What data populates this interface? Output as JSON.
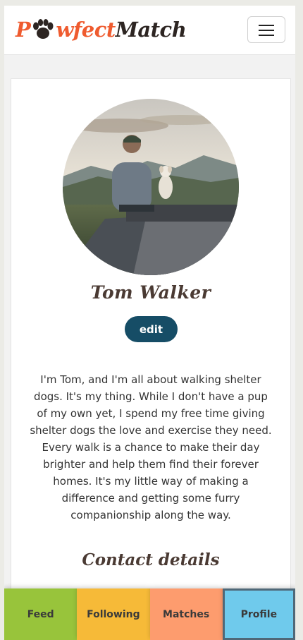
{
  "brand": {
    "part1": "P",
    "part2": "wfect",
    "part3": "Match"
  },
  "colors": {
    "brand_orange": "#ef5b2f",
    "edit_button": "#164d66",
    "tab_feed": "#98c43b",
    "tab_following": "#f6ba38",
    "tab_matches": "#fd9c6e",
    "tab_profile": "#6fcaec"
  },
  "icons": {
    "logo_paw": "paw-print-icon",
    "menu": "hamburger-menu-icon"
  },
  "profile": {
    "name": "Tom Walker",
    "edit_label": "edit",
    "bio": "I'm Tom, and I'm all about walking shelter dogs. It's my thing. While I don't have a pup of my own yet, I spend my free time giving shelter dogs the love and exercise they need. Every walk is a chance to make their day brighter and help them find their forever homes. It's my little way of making a difference and getting some furry companionship along the way.",
    "contact_title": "Contact details"
  },
  "bottom_nav": {
    "feed": "Feed",
    "following": "Following",
    "matches": "Matches",
    "profile": "Profile",
    "active": "Profile"
  }
}
